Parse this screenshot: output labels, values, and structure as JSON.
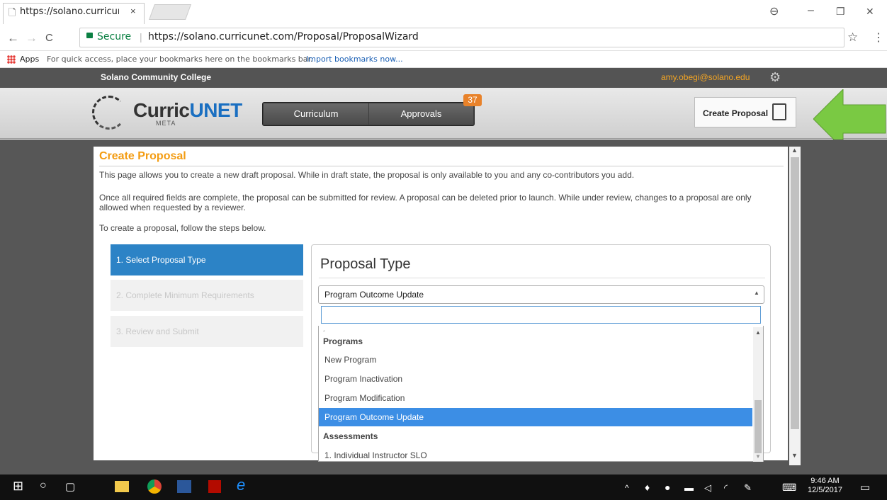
{
  "browser": {
    "tab_title": "https://solano.curricunet",
    "tab_close": "×",
    "secure_label": "Secure",
    "url_sep": "|",
    "url": "https://solano.curricunet.com/Proposal/ProposalWizard",
    "apps_label": "Apps",
    "bookmarks_hint": "For quick access, place your bookmarks here on the bookmarks bar.",
    "bookmarks_link": "Import bookmarks now...",
    "back": "←",
    "forward": "→",
    "reload": "C",
    "star": "☆",
    "menu": "⋮",
    "profile": "⊖",
    "minimize": "–",
    "restore": "❐",
    "close": "✕"
  },
  "site": {
    "college": "Solano Community College",
    "email": "amy.obegi@solano.edu",
    "logo_text": "CurricUNET",
    "logo_sub": "META",
    "nav": [
      "Curriculum",
      "Approvals"
    ],
    "approvals_badge": "37",
    "create_proposal": "Create Proposal"
  },
  "page": {
    "title": "Create Proposal",
    "p1": "This page allows you to create a new draft proposal. While in draft state, the proposal is only available to you and any co-contributors you add.",
    "p2": "Once all required fields are complete, the proposal can be submitted for review. A proposal can be deleted prior to launch. While under review, changes to a proposal are only allowed when requested by a reviewer.",
    "p3": "To create a proposal, follow the steps below.",
    "steps": [
      "1. Select Proposal Type",
      "2. Complete Minimum Requirements",
      "3. Review and Submit"
    ]
  },
  "proposal_type": {
    "heading": "Proposal Type",
    "selected": "Program Outcome Update",
    "search_value": "",
    "options": [
      {
        "label": "Programs",
        "group": true
      },
      {
        "label": "New Program",
        "group": false
      },
      {
        "label": "Program Inactivation",
        "group": false
      },
      {
        "label": "Program Modification",
        "group": false
      },
      {
        "label": "Program Outcome Update",
        "group": false,
        "selected": true
      },
      {
        "label": "Assessments",
        "group": true
      },
      {
        "label": "1. Individual Instructor SLO",
        "group": false
      }
    ]
  },
  "taskbar": {
    "time": "9:46 AM",
    "date": "12/5/2017"
  },
  "colors": {
    "accent_orange": "#f39c12",
    "step_active": "#2c83c6",
    "option_selected": "#3c8ee5",
    "arrow_green": "#7ac943"
  }
}
